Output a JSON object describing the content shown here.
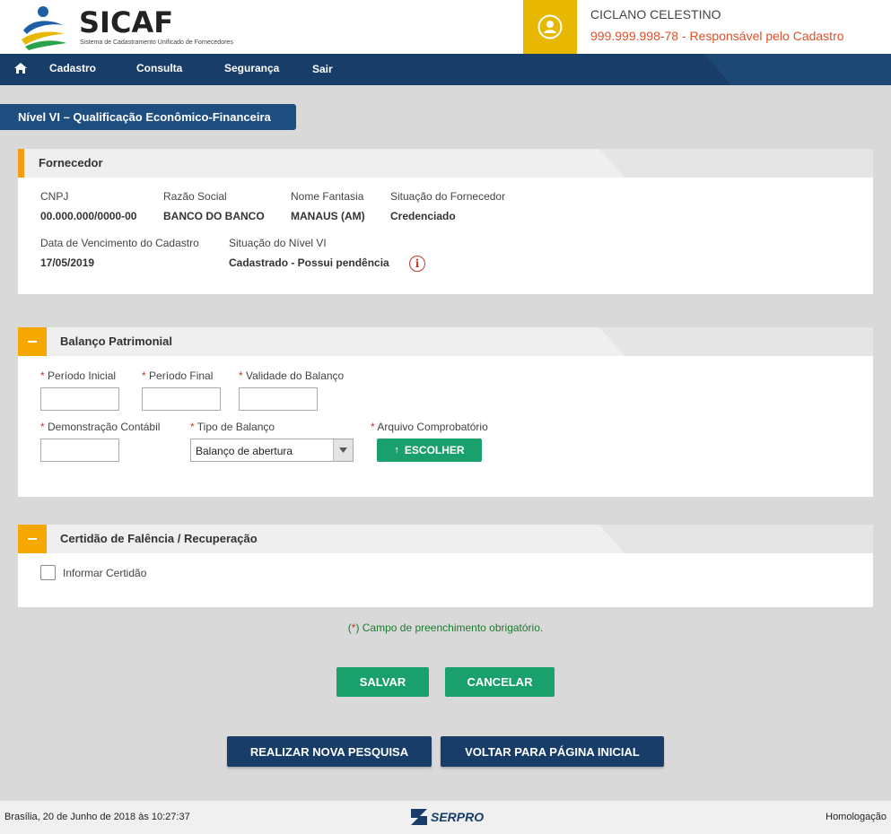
{
  "header": {
    "logo_title": "SICAF",
    "logo_subtitle": "Sistema de Cadastramento Unificado de Fornecedores",
    "user_name": "CICLANO CELESTINO",
    "user_role": "999.999.998-78 - Responsável pelo Cadastro"
  },
  "nav": {
    "items": [
      "Cadastro",
      "Consulta",
      "Segurança",
      "Sair"
    ]
  },
  "page_title": "Nível VI – Qualificação Econômico-Financeira",
  "fornecedor": {
    "title": "Fornecedor",
    "cnpj_label": "CNPJ",
    "cnpj_value": "00.000.000/0000-00",
    "razao_label": "Razão Social",
    "razao_value": "BANCO DO BANCO",
    "fantasia_label": "Nome Fantasia",
    "fantasia_value": "MANAUS (AM)",
    "situacao_label": "Situação do Fornecedor",
    "situacao_value": "Credenciado",
    "vencimento_label": "Data de Vencimento do Cadastro",
    "vencimento_value": "17/05/2019",
    "nivel_label": "Situação do Nível VI",
    "nivel_value": "Cadastrado - Possui pendência",
    "info_glyph": "i"
  },
  "balanco": {
    "title": "Balanço Patrimonial",
    "req_mark": "*",
    "periodo_inicial_label": "Período Inicial",
    "periodo_final_label": "Período Final",
    "validade_label": "Validade do Balanço",
    "demonstracao_label": "Demonstração Contábil",
    "tipo_label": "Tipo de Balanço",
    "tipo_value": "Balanço de abertura",
    "arquivo_label": "Arquivo Comprobatório",
    "escolher_label": "ESCOLHER",
    "upload_glyph": "↑"
  },
  "certidao": {
    "title": "Certidão de Falência / Recuperação",
    "informar_label": "Informar Certidão"
  },
  "note": {
    "open": "(",
    "mark": "*",
    "text": ") Campo de preenchimento obrigatório."
  },
  "actions": {
    "salvar": "SALVAR",
    "cancelar": "CANCELAR",
    "nova_pesquisa": "REALIZAR NOVA PESQUISA",
    "voltar": "VOLTAR PARA PÁGINA INICIAL"
  },
  "footer": {
    "datetime": "Brasília, 20 de Junho de 2018 às 10:27:37",
    "brand": "SERPRO",
    "env": "Homologação"
  },
  "colors": {
    "navy": "#173d68",
    "orange": "#f5a800",
    "green": "#1aa06d",
    "avatar_bg": "#e8b800",
    "role_text": "#e0502a"
  },
  "icons": [
    "home-icon",
    "user-avatar-icon",
    "info-icon",
    "upload-icon",
    "chevron-down-icon",
    "minus-icon",
    "serpro-logo-icon"
  ]
}
